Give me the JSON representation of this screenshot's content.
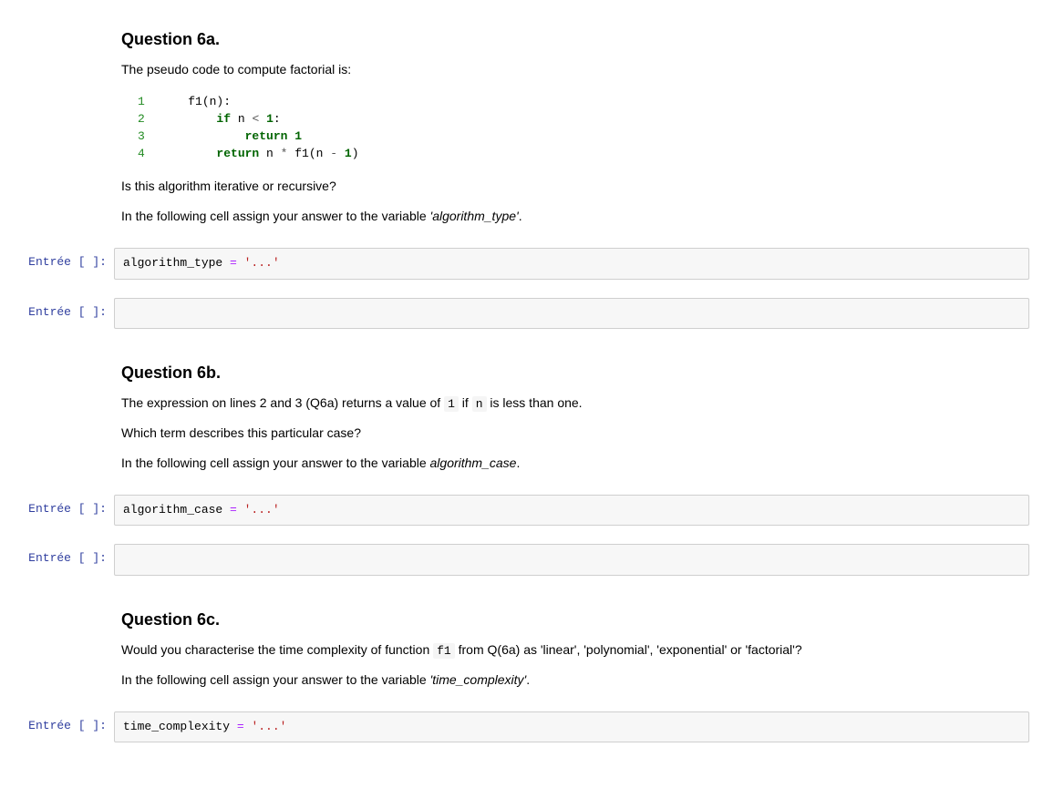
{
  "prompt_label": "Entrée [ ]:",
  "questions": {
    "q6a": {
      "title": "Question 6a.",
      "intro": "The pseudo code to compute factorial is:",
      "code_lines": [
        {
          "n": "1",
          "indent": 2,
          "tokens": [
            {
              "t": "f1(n):",
              "c": ""
            }
          ]
        },
        {
          "n": "2",
          "indent": 4,
          "tokens": [
            {
              "t": "if",
              "c": "kw"
            },
            {
              "t": " n ",
              "c": ""
            },
            {
              "t": "<",
              "c": "op"
            },
            {
              "t": " ",
              "c": ""
            },
            {
              "t": "1",
              "c": "num"
            },
            {
              "t": ":",
              "c": ""
            }
          ]
        },
        {
          "n": "3",
          "indent": 6,
          "tokens": [
            {
              "t": "return",
              "c": "kw"
            },
            {
              "t": " ",
              "c": ""
            },
            {
              "t": "1",
              "c": "num"
            }
          ]
        },
        {
          "n": "4",
          "indent": 4,
          "tokens": [
            {
              "t": "return",
              "c": "kw"
            },
            {
              "t": " n ",
              "c": ""
            },
            {
              "t": "*",
              "c": "op"
            },
            {
              "t": " f1(n ",
              "c": ""
            },
            {
              "t": "-",
              "c": "op"
            },
            {
              "t": " ",
              "c": ""
            },
            {
              "t": "1",
              "c": "num"
            },
            {
              "t": ")",
              "c": ""
            }
          ]
        }
      ],
      "question": "Is this algorithm iterative or recursive?",
      "instruction_prefix": "In the following cell assign your answer to the variable ",
      "instruction_var": "'algorithm_type'",
      "instruction_suffix": "."
    },
    "q6b": {
      "title": "Question 6b.",
      "line1_a": "The expression on lines 2 and 3 (Q6a) returns a value of ",
      "line1_code1": "1",
      "line1_b": " if ",
      "line1_code2": "n",
      "line1_c": " is less than one.",
      "question": "Which term describes this particular case?",
      "instruction_prefix": "In the following cell assign your answer to the variable ",
      "instruction_var": "algorithm_case",
      "instruction_suffix": "."
    },
    "q6c": {
      "title": "Question 6c.",
      "line1_a": "Would you characterise the time complexity of function ",
      "line1_code1": "f1",
      "line1_b": " from Q(6a) as 'linear', 'polynomial', 'exponential' or 'factorial'?",
      "instruction_prefix": "In the following cell assign your answer to the variable ",
      "instruction_var": "'time_complexity'",
      "instruction_suffix": "."
    }
  },
  "code_cells": {
    "c1": {
      "var": "algorithm_type",
      "op": " = ",
      "str": "'...'"
    },
    "c2": {
      "content": ""
    },
    "c3": {
      "var": "algorithm_case",
      "op": " = ",
      "str": "'...'"
    },
    "c4": {
      "content": ""
    },
    "c5": {
      "var": "time_complexity",
      "op": " = ",
      "str": "'...'"
    }
  }
}
